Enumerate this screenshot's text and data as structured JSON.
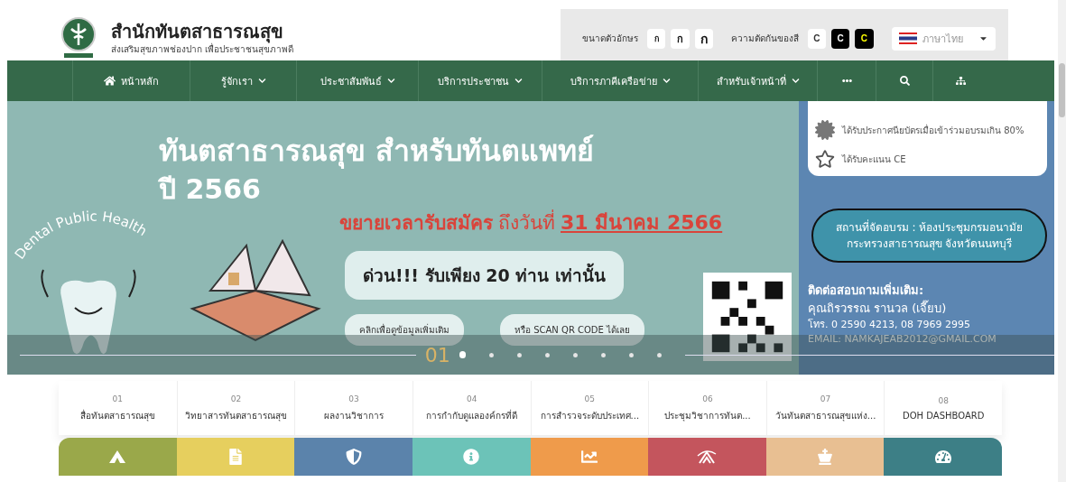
{
  "header": {
    "title": "สำนักทันตสาธารณสุข",
    "subtitle": "ส่งเสริมสุขภาพช่องปาก เพื่อประชาชนสุขภาพดี"
  },
  "accessibility": {
    "font_size_label": "ขนาดตัวอักษร",
    "font_sizes": [
      {
        "label": "ก",
        "kind": "small"
      },
      {
        "label": "ก",
        "kind": "medium"
      },
      {
        "label": "ก",
        "kind": "large"
      }
    ],
    "contrast_label": "ความตัดกันของสี",
    "contrast": [
      {
        "label": "C",
        "kind": "normal"
      },
      {
        "label": "C",
        "kind": "dark"
      },
      {
        "label": "C",
        "kind": "yellow"
      }
    ],
    "language": "ภาษาไทย"
  },
  "nav": [
    {
      "label": "หน้าหลัก",
      "kind": "home"
    },
    {
      "label": "รู้จักเรา",
      "kind": "dropdown"
    },
    {
      "label": "ประชาสัมพันธ์",
      "kind": "dropdown"
    },
    {
      "label": "บริการประชาชน",
      "kind": "dropdown"
    },
    {
      "label": "บริการภาคีเครือข่าย",
      "kind": "dropdown"
    },
    {
      "label": "สำหรับเจ้าหน้าที่",
      "kind": "dropdown"
    },
    {
      "kind": "more"
    },
    {
      "kind": "search"
    },
    {
      "kind": "sitemap"
    }
  ],
  "banner": {
    "art_text": "Dental Public Health",
    "headline": "ทันตสาธารณสุข สำหรับทันตแพทย์",
    "year": "ปี 2566",
    "extend": "ขยายเวลารับสมัคร",
    "until": "ถึงวันที่",
    "deadline": "31 มีนาคม 2566",
    "urgent": "ด่วน!!! รับเพียง 20 ท่าน เท่านั้น",
    "more_info": "คลิกเพื่อดูข้อมูลเพิ่มเติม",
    "scan": "หรือ SCAN QR CODE ได้เลย",
    "benefits": [
      {
        "text": "ได้รับประกาศนียบัตรเมื่อเข้าร่วมอบรมเกิน 80%",
        "kind": "certificate"
      },
      {
        "text": "ได้รับคะแนน CE",
        "kind": "star"
      }
    ],
    "venue": "สถานที่จัดอบรม : ห้องประชุมกรมอนามัย กระทรวงสาธารณสุข จังหวัดนนทบุรี",
    "contact_title": "ติดต่อสอบถามเพิ่มเติม:",
    "contact_name": "คุณถิรวรรณ รานวล (เจี๊ยบ)",
    "contact_phone": "โทร. 0 2590 4213, 08 7969 2995",
    "contact_email": "EMAIL: NAMKAJEAB2012@GMAIL.COM"
  },
  "slider": {
    "current": "01",
    "dots": [
      {
        "selected": true
      },
      {
        "selected": false
      },
      {
        "selected": false
      },
      {
        "selected": false
      },
      {
        "selected": false
      },
      {
        "selected": false
      },
      {
        "selected": false
      },
      {
        "selected": false
      }
    ]
  },
  "quick_links": [
    {
      "number": "01",
      "label": "สื่อทันตสาธารณสุข"
    },
    {
      "number": "02",
      "label": "วิทยาสารทันตสาธารณสุข"
    },
    {
      "number": "03",
      "label": "ผลงานวิชาการ"
    },
    {
      "number": "04",
      "label": "การกำกับดูแลองค์กรที่ดี"
    },
    {
      "number": "05",
      "label": "การสำรวจระดับประเทศ..."
    },
    {
      "number": "06",
      "label": "ประชุมวิชาการทันต..."
    },
    {
      "number": "07",
      "label": "วันทันตสาธารณสุขแห่ง..."
    },
    {
      "number": "08",
      "label": "DOH DASHBOARD"
    }
  ],
  "tiles": [
    {
      "kind": "peak",
      "color": "#9aa84a"
    },
    {
      "kind": "document",
      "color": "#e6cf5e"
    },
    {
      "kind": "shield",
      "color": "#5b83ab"
    },
    {
      "kind": "info",
      "color": "#6cc3b8"
    },
    {
      "kind": "chart",
      "color": "#ef9b4b"
    },
    {
      "kind": "swoosh",
      "color": "#c4555d"
    },
    {
      "kind": "chess",
      "color": "#e8bf92"
    },
    {
      "kind": "gauge",
      "color": "#3d7f86"
    }
  ]
}
